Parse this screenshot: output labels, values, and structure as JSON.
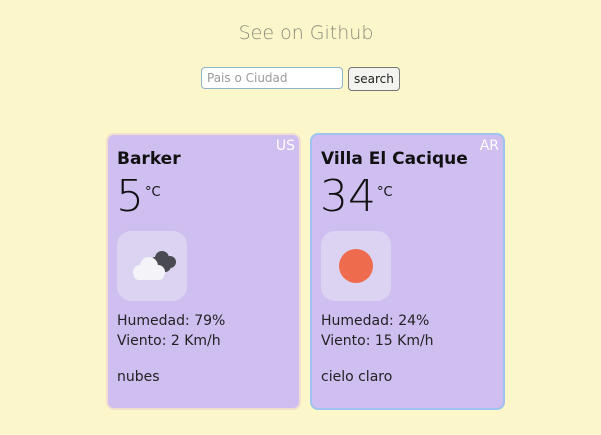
{
  "header": {
    "github_label": "See on Github"
  },
  "search": {
    "placeholder": "Pais o Ciudad",
    "value": "",
    "button_label": "search"
  },
  "cards": [
    {
      "city": "Barker",
      "country": "US",
      "temp": "5",
      "unit": "°C",
      "icon": "cloudy-icon",
      "humidity_label": "Humedad:",
      "humidity": "79%",
      "wind_label": "Viento:",
      "wind": "2 Km/h",
      "description": "nubes"
    },
    {
      "city": "Villa El Cacique",
      "country": "AR",
      "temp": "34",
      "unit": "°C",
      "icon": "sun-icon",
      "humidity_label": "Humedad:",
      "humidity": "24%",
      "wind_label": "Viento:",
      "wind": "15 Km/h",
      "description": "cielo claro"
    }
  ],
  "colors": {
    "background": "#fbf7cb",
    "card": "#cfbef0",
    "sun": "#ee6b4d"
  }
}
